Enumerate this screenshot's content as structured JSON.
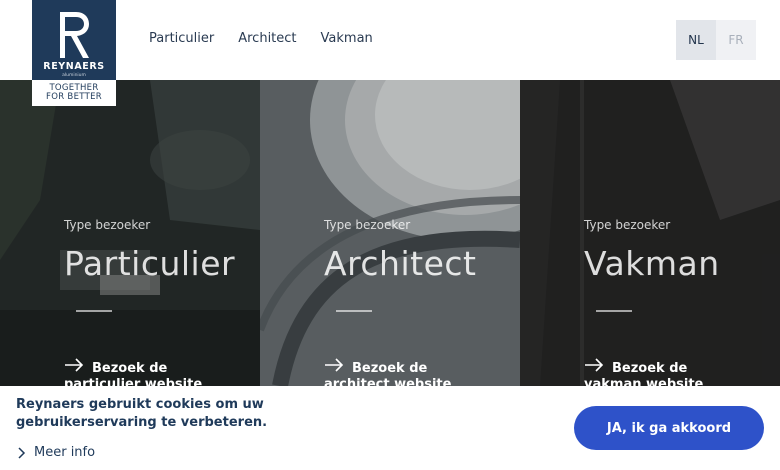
{
  "brand": {
    "name": "REYNAERS",
    "sub": "aluminium",
    "tagline_line1": "TOGETHER",
    "tagline_line2": "FOR BETTER"
  },
  "nav": {
    "items": [
      "Particulier",
      "Architect",
      "Vakman"
    ]
  },
  "languages": {
    "active": "NL",
    "inactive": "FR"
  },
  "panels": [
    {
      "type_label": "Type bezoeker",
      "title": "Particulier",
      "link_line1": "Bezoek de",
      "link_line2": "particulier website"
    },
    {
      "type_label": "Type bezoeker",
      "title": "Architect",
      "link_line1": "Bezoek de",
      "link_line2": "architect website"
    },
    {
      "type_label": "Type bezoeker",
      "title": "Vakman",
      "link_line1": "Bezoek de",
      "link_line2": "vakman website"
    }
  ],
  "cookie": {
    "message": "Reynaers gebruikt cookies om uw gebruikerservaring te verbeteren.",
    "more_info": "Meer info",
    "accept_label": "JA, ik ga akkoord"
  },
  "colors": {
    "brand_navy": "#1f3a5a",
    "accept_blue": "#2e52c9"
  }
}
